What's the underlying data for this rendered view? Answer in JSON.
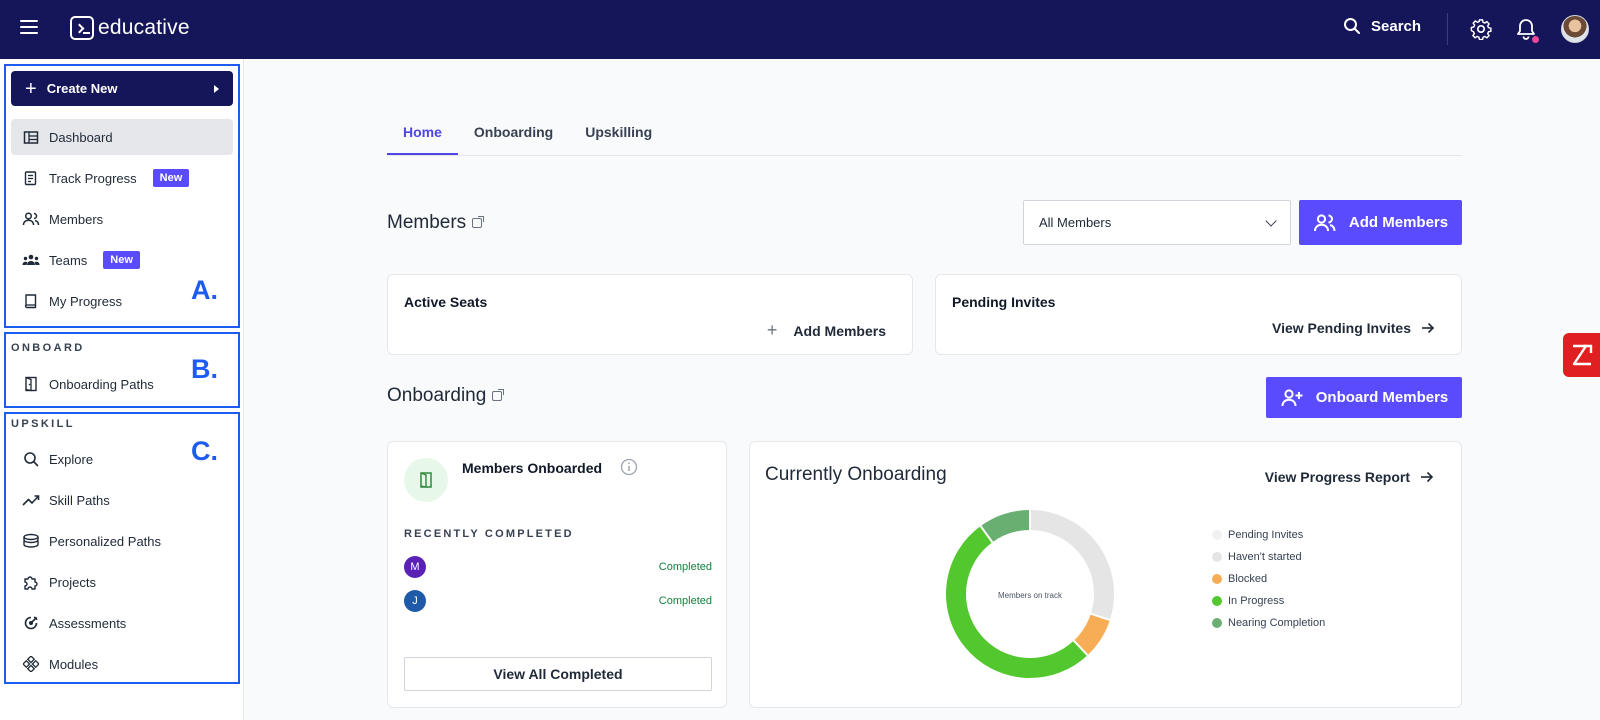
{
  "header": {
    "logo_text": "educative",
    "search_label": "Search"
  },
  "sidebar": {
    "create_new": "Create New",
    "items_a": [
      {
        "label": "Dashboard",
        "icon": "dashboard-icon",
        "active": true
      },
      {
        "label": "Track Progress",
        "icon": "track-progress-icon",
        "badge": "New"
      },
      {
        "label": "Members",
        "icon": "members-icon"
      },
      {
        "label": "Teams",
        "icon": "teams-icon",
        "badge": "New"
      },
      {
        "label": "My Progress",
        "icon": "book-icon"
      }
    ],
    "section_b_title": "ONBOARD",
    "items_b": [
      {
        "label": "Onboarding Paths",
        "icon": "door-icon"
      }
    ],
    "section_c_title": "UPSKILL",
    "items_c": [
      {
        "label": "Explore",
        "icon": "search-icon"
      },
      {
        "label": "Skill Paths",
        "icon": "trend-icon"
      },
      {
        "label": "Personalized Paths",
        "icon": "layers-icon"
      },
      {
        "label": "Projects",
        "icon": "puzzle-icon"
      },
      {
        "label": "Assessments",
        "icon": "assessment-icon"
      },
      {
        "label": "Modules",
        "icon": "modules-icon"
      }
    ],
    "annotations": {
      "a": "A.",
      "b": "B.",
      "c": "C."
    }
  },
  "tabs": [
    "Home",
    "Onboarding",
    "Upskilling"
  ],
  "members": {
    "title": "Members",
    "filter_value": "All Members",
    "add_button": "Add Members",
    "active_seats": {
      "title": "Active Seats",
      "link": "Add Members"
    },
    "pending_invites": {
      "title": "Pending Invites",
      "link": "View Pending Invites"
    }
  },
  "onboarding": {
    "title": "Onboarding",
    "onboard_button": "Onboard Members",
    "members_onboarded": {
      "title": "Members Onboarded",
      "recent_label": "RECENTLY COMPLETED",
      "recent": [
        {
          "initial": "M",
          "color": "#5b21b6",
          "status": "Completed"
        },
        {
          "initial": "J",
          "color": "#1e5aa8",
          "status": "Completed"
        }
      ],
      "view_all": "View All Completed"
    },
    "currently": {
      "title": "Currently Onboarding",
      "link": "View Progress Report",
      "center_label": "Members on track"
    }
  },
  "chart_data": {
    "type": "pie",
    "categories": [
      "Pending Invites",
      "Haven't started",
      "Blocked",
      "In Progress",
      "Nearing Completion"
    ],
    "values": [
      0,
      30,
      8,
      52,
      10
    ],
    "colors": [
      "#f1f1f1",
      "#e5e5e5",
      "#f6ad55",
      "#52c72e",
      "#6aaf72"
    ],
    "legend": "right"
  }
}
